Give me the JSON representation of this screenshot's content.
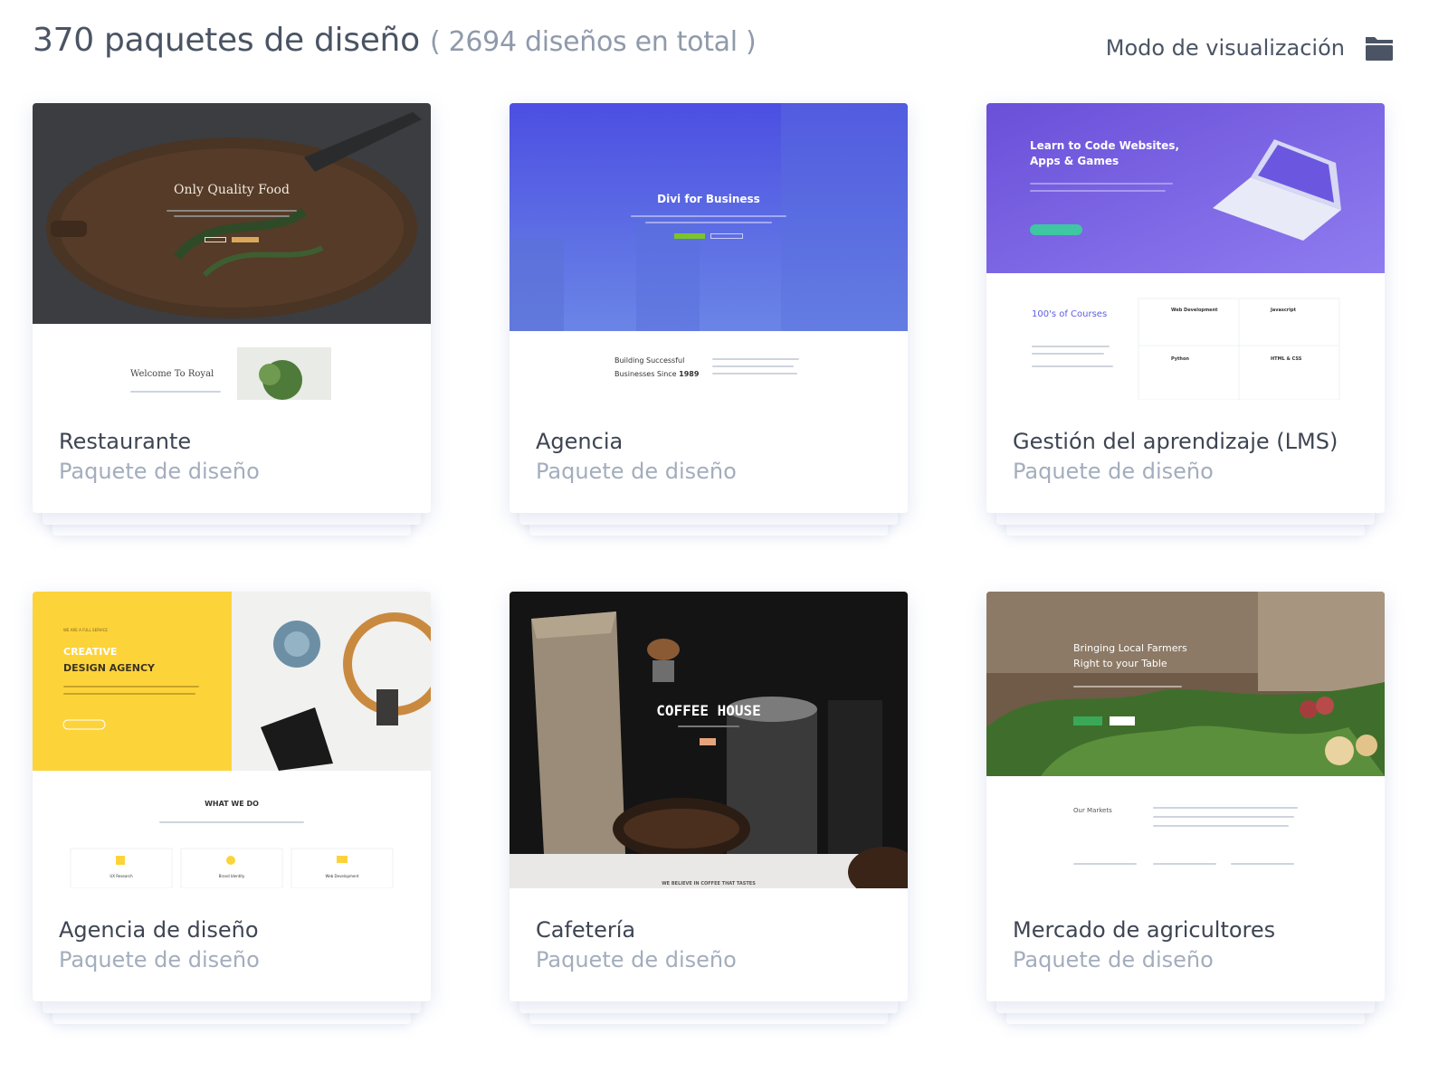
{
  "header": {
    "title": "370 paquetes de diseño",
    "total": "( 2694 diseños en total )",
    "view_mode_label": "Modo de visualización",
    "view_mode_icon": "folder-icon"
  },
  "colors": {
    "title": "#4a5464",
    "muted": "#a3adbd",
    "accent_purple": "#5b5ee0",
    "accent_yellow": "#fdd33a"
  },
  "layouts": [
    {
      "name": "Restaurante",
      "subtitle": "Paquete de diseño",
      "preview": {
        "hero_title": "Only Quality Food",
        "section_title": "Welcome To Royal"
      }
    },
    {
      "name": "Agencia",
      "subtitle": "Paquete de diseño",
      "preview": {
        "hero_title": "Divi for Business",
        "section_line1": "Building Successful",
        "section_line2": "Businesses Since",
        "section_year": "1989"
      }
    },
    {
      "name": "Gestión del aprendizaje (LMS)",
      "subtitle": "Paquete de diseño",
      "preview": {
        "hero_line1": "Learn to Code Websites,",
        "hero_line2": "Apps & Games",
        "section_title": "100's of Courses",
        "course_1": "Web Development",
        "course_2": "Javascript",
        "course_3": "Python",
        "course_4": "HTML & CSS"
      }
    },
    {
      "name": "Agencia de diseño",
      "subtitle": "Paquete de diseño",
      "preview": {
        "eyebrow": "WE ARE A FULL SERVICE",
        "hero_line1": "CREATIVE",
        "hero_line2": "DESIGN AGENCY",
        "section_title": "WHAT WE DO",
        "service_1": "UX Research",
        "service_2": "Brand Identity",
        "service_3": "Web Development"
      }
    },
    {
      "name": "Cafetería",
      "subtitle": "Paquete de diseño",
      "preview": {
        "hero_title": "COFFEE HOUSE",
        "strip_text": "WE BELIEVE IN COFFEE THAT TASTES"
      }
    },
    {
      "name": "Mercado de agricultores",
      "subtitle": "Paquete de diseño",
      "preview": {
        "hero_line1": "Bringing Local Farmers",
        "hero_line2": "Right to your Table",
        "section_title": "Our Markets"
      }
    }
  ]
}
